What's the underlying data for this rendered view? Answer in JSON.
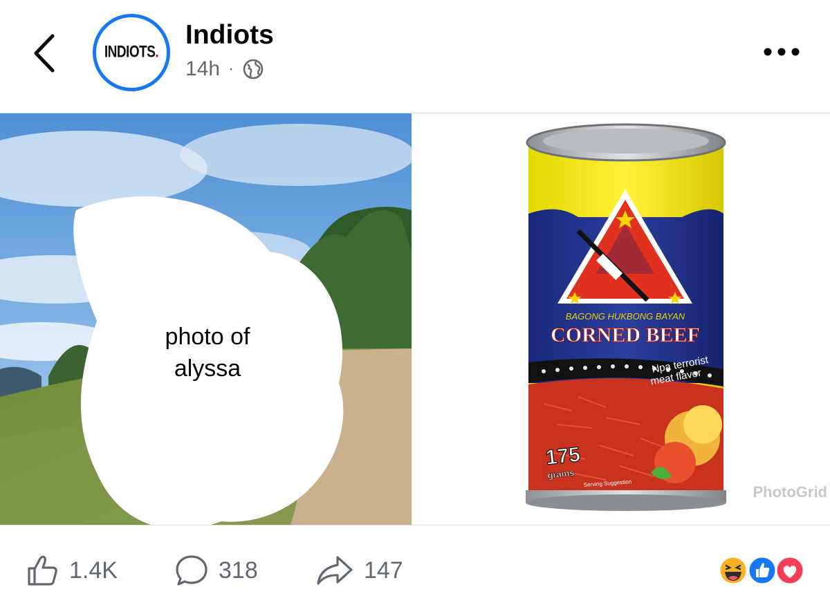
{
  "header": {
    "back_icon": "chevron-left-icon",
    "avatar_text": "INDIOTS",
    "avatar_dot": ".",
    "page_name": "Indiots",
    "time": "14h",
    "separator": "·",
    "privacy_icon": "globe-icon",
    "more_icon": "more-dots-icon"
  },
  "photos": {
    "left_label": "photo of alyssa",
    "can_texts": {
      "brand_strip": "BAGONG HUKBONG BAYAN",
      "product": "CORNED BEEF",
      "flavor_line1": "Npa terrorist",
      "flavor_line2": "meat flavor",
      "weight": "175",
      "weight_unit": "grams",
      "suggestion": "Serving Suggestion"
    },
    "watermark": "PhotoGrid"
  },
  "footer": {
    "likes": "1.4K",
    "comments": "318",
    "shares": "147",
    "reaction_icons": [
      "haha-icon",
      "like-icon",
      "love-icon"
    ]
  },
  "colors": {
    "accent": "#1877f2",
    "text_secondary": "#65676b",
    "love": "#f33e58",
    "haha": "#f7b125"
  }
}
